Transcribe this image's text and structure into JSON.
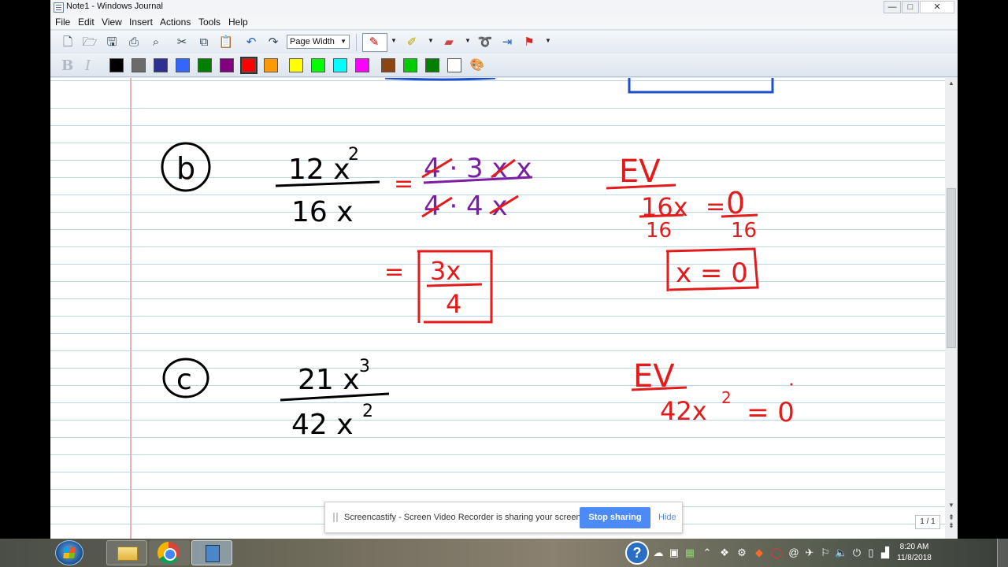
{
  "window": {
    "title": "Note1 - Windows Journal",
    "min_glyph": "—",
    "max_glyph": "□",
    "close_glyph": "✕"
  },
  "menu": [
    "File",
    "Edit",
    "View",
    "Insert",
    "Actions",
    "Tools",
    "Help"
  ],
  "toolbar": {
    "zoom_value": "Page Width",
    "format_bold": "B",
    "format_italic": "I",
    "swatches": [
      "#000000",
      "#6b6b6b",
      "#2e3192",
      "#3366ff",
      "#008000",
      "#800080",
      "#ff0000",
      "#ff9900",
      "#ffff00",
      "#00ff00",
      "#00ffff",
      "#ff00ff",
      "#8b4513",
      "#00cc00",
      "#008000",
      "#ffffff"
    ]
  },
  "page": {
    "indicator": "1 / 1"
  },
  "notes": {
    "ink_colors": {
      "black": "#000000",
      "purple": "#7a1fa2",
      "red": "#e31b1b",
      "blue": "#1f4fd1"
    },
    "problem_b": {
      "label": "b",
      "numerator": "12 x",
      "numerator_exp": "2",
      "denominator": "16 x",
      "eq": "=",
      "factored_num": "4 · 3 x x",
      "factored_den": "4 · 4 x",
      "result_eq": "=",
      "result_num": "3x",
      "result_den": "4",
      "ev_label": "EV",
      "ev_left": "16x",
      "ev_eq": "=",
      "ev_right": "0",
      "ev_div_left": "16",
      "ev_div_right": "16",
      "ev_answer": "x = 0"
    },
    "problem_c": {
      "label": "c",
      "numerator": "21 x",
      "numerator_exp": "3",
      "denominator": "42 x",
      "denominator_exp": "2",
      "ev_label": "EV",
      "ev_expr": "42x",
      "ev_exp": "2",
      "ev_rhs": "= 0"
    }
  },
  "sharebar": {
    "message": "Screencastify - Screen Video Recorder is sharing your screen.",
    "stop_label": "Stop sharing",
    "hide_label": "Hide"
  },
  "taskbar": {
    "help_glyph": "?",
    "time": "8:20 AM",
    "date": "11/8/2018"
  }
}
